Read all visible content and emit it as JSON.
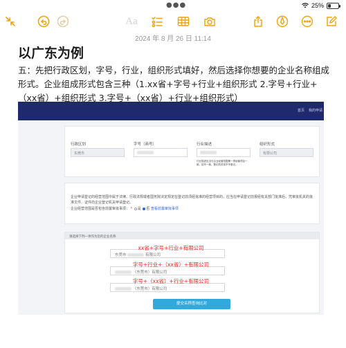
{
  "status": {
    "battery_percent_text": "25%",
    "battery_level": 0.25,
    "icons": [
      "more-dots-icon",
      "wifi-icon",
      "battery-icon"
    ]
  },
  "toolbar": {
    "icons": [
      "collapse-icon",
      "undo-icon",
      "redo-icon",
      "text-format-icon",
      "checklist-icon",
      "table-icon",
      "camera-icon",
      "share-icon",
      "markup-pen-icon",
      "more-icon",
      "compose-icon"
    ],
    "format_label": "Aa",
    "accent_color": "#f0a30a"
  },
  "note": {
    "date": "2024 年 8 月 26 日 11:14",
    "title": "以广东为例",
    "body": "五：先把行政区划，字号，行业，组织形式填好，然后选择你想要的企业名称组成形式。企业组成形式包含三种（1.xx省+字号+行业+组织形式  2.字号+行业+（xx省）+组织形式 3.字号+（xx省）+行业+组织形式）"
  },
  "screenshot": {
    "nav_links": [
      "首页",
      "我的申请"
    ],
    "fields": {
      "region_label": "行政区划",
      "region_value": "东莞市",
      "brand_label": "字号（商号）",
      "industry_label": "行业描述",
      "industry_note": "行业描述应当与企业经营范围第一项经营项目一致，如不一致，登记机关将不予登记。",
      "org_label": "组织形式",
      "org_value": "有限公司"
    },
    "info": {
      "line1": "企业申请登记的经营范围中属于法律、行政法规或者国务院决定规定在登记前须经批准的经营项目的，应当在申请登记前报经有关部门批准后，凭审批机关的批准文件、证件向企业登记机关申请登记。",
      "question": "企业经营范围是否包含前置审批事项：",
      "option_yes": "是",
      "option_no": "否",
      "link": "查看前置审批事项"
    },
    "select": {
      "header": "请选择下列一项作为您的企业名称",
      "options": [
        {
          "red_label": "xx省+字号+行业+有限公司",
          "prefix": "东莞市",
          "suffix": "有限公司"
        },
        {
          "red_label": "字号+行业+（xx省）+有限公司",
          "prefix": "",
          "suffix": "（东莞市）有限公司"
        },
        {
          "red_label": "字号+（xx省）+行业+有限公司",
          "prefix": "",
          "suffix": "（东莞市）有限公司"
        }
      ],
      "submit_label": "提交名称查询比对"
    }
  }
}
